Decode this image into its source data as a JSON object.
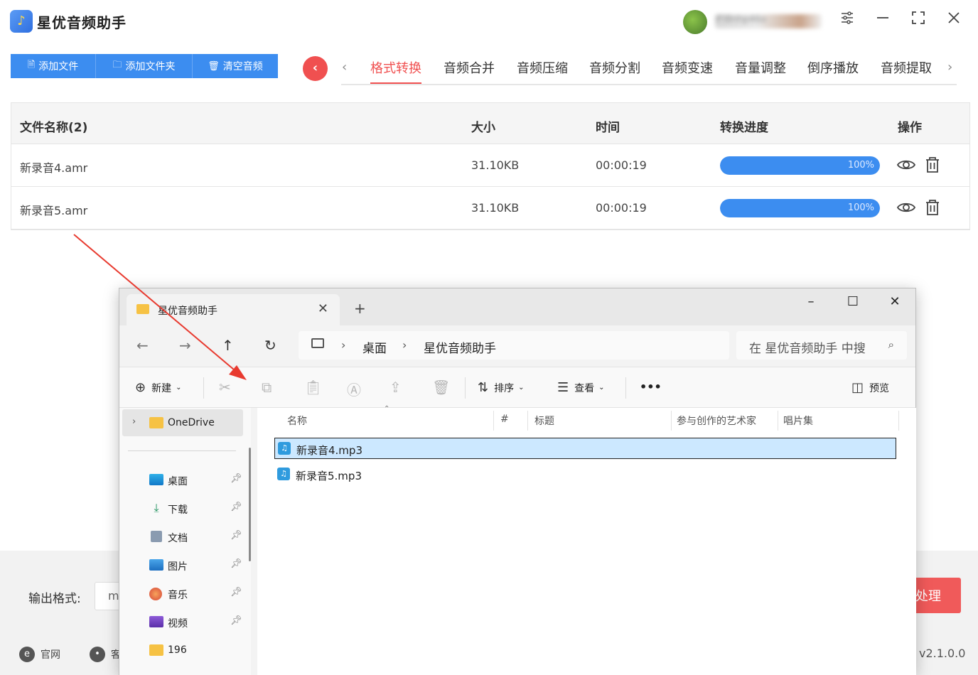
{
  "app": {
    "title": "星优音频助手",
    "user_name": "iFl8nhp46o",
    "buttons": {
      "add_file": "添加文件",
      "add_folder": "添加文件夹",
      "clear": "清空音频"
    },
    "tabs": [
      "格式转换",
      "音频合并",
      "音频压缩",
      "音频分割",
      "音频变速",
      "音量调整",
      "倒序播放",
      "音频提取"
    ],
    "active_tab": "格式转换",
    "table": {
      "headers": {
        "name": "文件名称(2)",
        "size": "大小",
        "time": "时间",
        "progress": "转换进度",
        "action": "操作"
      },
      "rows": [
        {
          "name": "新录音4.amr",
          "size": "31.10KB",
          "time": "00:00:19",
          "progress_label": "100%",
          "progress": 1.0
        },
        {
          "name": "新录音5.amr",
          "size": "31.10KB",
          "time": "00:00:19",
          "progress_label": "100%",
          "progress": 1.0
        }
      ]
    },
    "output_label": "输出格式:",
    "output_value": "m",
    "process_button": "处理",
    "footer": {
      "website": "官网",
      "service": "客"
    },
    "version": "v2.1.0.0",
    "colors": {
      "accent_blue": "#3c8df0",
      "accent_red": "#f05050"
    }
  },
  "explorer": {
    "tab_title": "星优音频助手",
    "breadcrumb": [
      "桌面",
      "星优音频助手"
    ],
    "search_placeholder": "在 星优音频助手 中搜",
    "commands": {
      "new": "新建",
      "sort": "排序",
      "view": "查看",
      "more": "•••",
      "preview": "预览"
    },
    "sidebar": {
      "onedrive": "OneDrive",
      "items": [
        {
          "label": "桌面",
          "icon": "desktop-icon",
          "pinned": true
        },
        {
          "label": "下载",
          "icon": "download-icon",
          "pinned": true
        },
        {
          "label": "文档",
          "icon": "document-icon",
          "pinned": true
        },
        {
          "label": "图片",
          "icon": "picture-icon",
          "pinned": true
        },
        {
          "label": "音乐",
          "icon": "music-icon",
          "pinned": true
        },
        {
          "label": "视频",
          "icon": "video-icon",
          "pinned": true
        },
        {
          "label": "196",
          "icon": "folder-icon",
          "pinned": false
        }
      ]
    },
    "columns": [
      "名称",
      "#",
      "标题",
      "参与创作的艺术家",
      "唱片集"
    ],
    "files": [
      {
        "name": "新录音4.mp3",
        "selected": true
      },
      {
        "name": "新录音5.mp3",
        "selected": false
      }
    ]
  }
}
